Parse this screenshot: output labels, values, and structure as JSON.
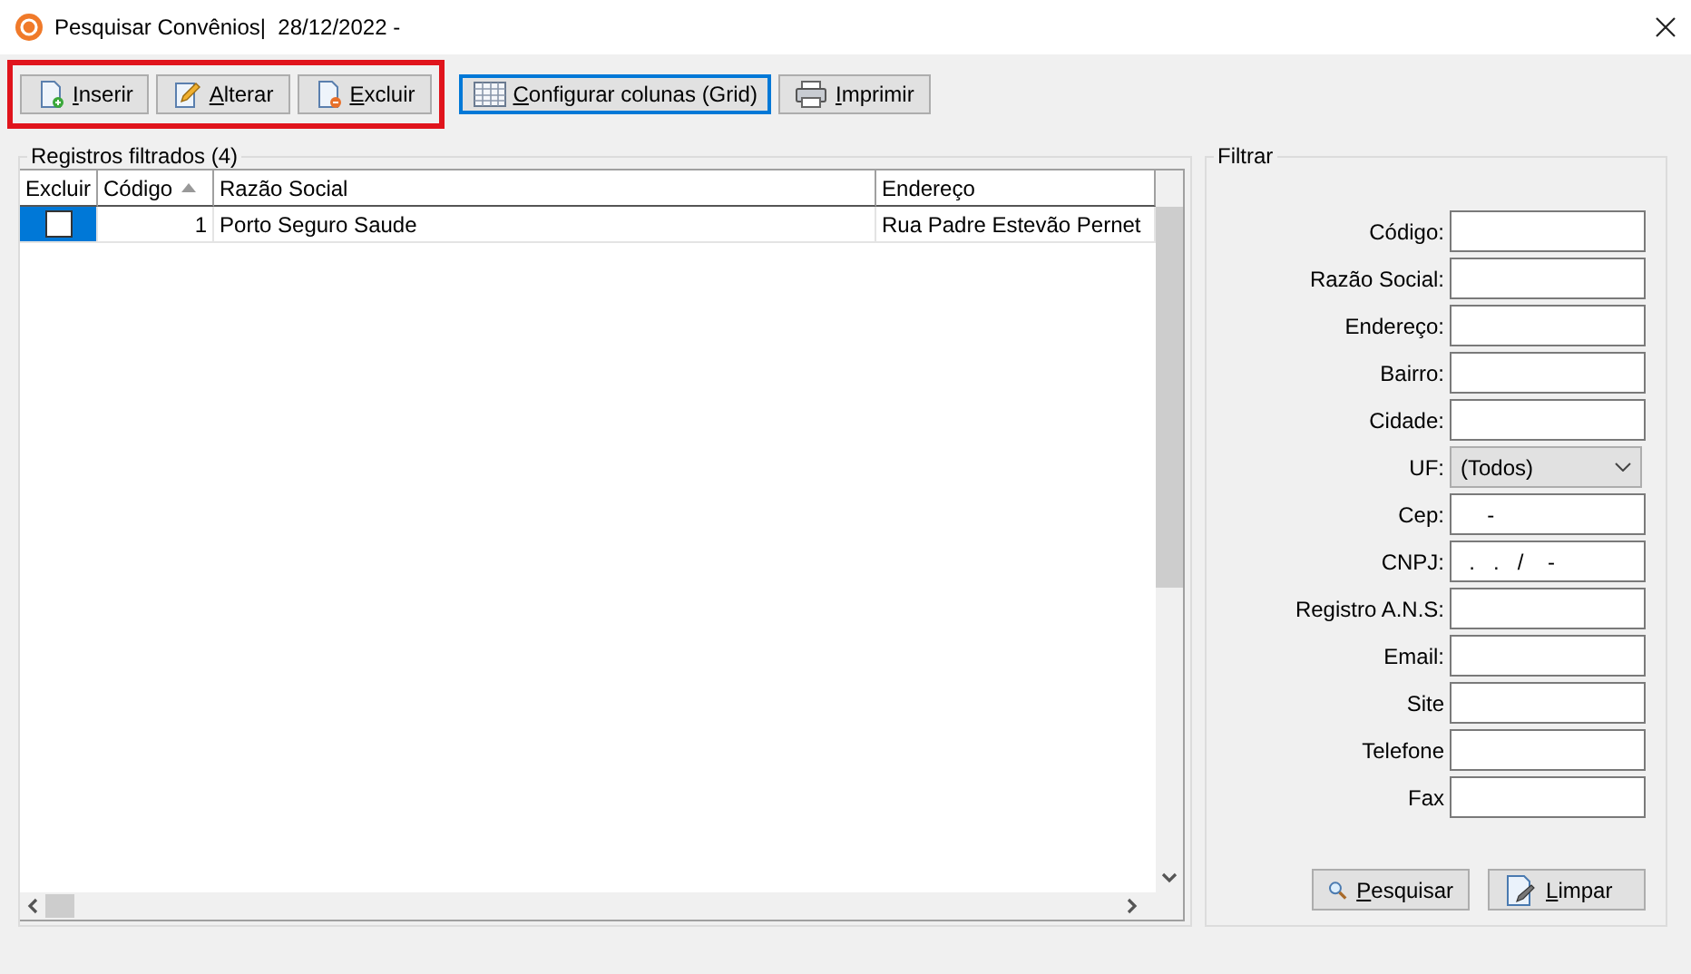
{
  "window": {
    "title": "Pesquisar Convênios|  28/12/2022 -"
  },
  "toolbar": [
    {
      "label": "Inserir",
      "kind": "insert",
      "highlighted": true,
      "focused": false
    },
    {
      "label": "Alterar",
      "kind": "edit",
      "highlighted": true,
      "focused": false
    },
    {
      "label": "Excluir",
      "kind": "delete",
      "highlighted": true,
      "focused": false
    },
    {
      "label": "Configurar colunas (Grid)",
      "kind": "columns",
      "highlighted": false,
      "focused": true
    },
    {
      "label": "Imprimir",
      "kind": "print",
      "highlighted": false,
      "focused": false
    }
  ],
  "grid": {
    "title": "Registros filtrados (4)",
    "columns": [
      {
        "label": "Excluir",
        "sorted": false
      },
      {
        "label": "Código",
        "sorted": true
      },
      {
        "label": "Razão Social",
        "sorted": false
      },
      {
        "label": "Endereço",
        "sorted": false
      }
    ],
    "rows": [
      {
        "selected": true,
        "cells": [
          {
            "checked": false
          },
          "1",
          "Porto Seguro Saude",
          "Rua Padre Estevão Pernet"
        ]
      }
    ]
  },
  "filter": {
    "title": "Filtrar",
    "fields": [
      {
        "label": "Código:",
        "kind": "text"
      },
      {
        "label": "Razão Social:",
        "kind": "text"
      },
      {
        "label": "Endereço:",
        "kind": "text"
      },
      {
        "label": "Bairro:",
        "kind": "text"
      },
      {
        "label": "Cidade:",
        "kind": "text"
      },
      {
        "label": "UF:",
        "kind": "select",
        "value": "(Todos)"
      },
      {
        "label": "Cep:",
        "kind": "text",
        "value": "     -"
      },
      {
        "label": "CNPJ:",
        "kind": "text",
        "value": "  .   .   /    -"
      },
      {
        "label": "Registro A.N.S:",
        "kind": "text"
      },
      {
        "label": "Email:",
        "kind": "text"
      },
      {
        "label": "Site",
        "kind": "text"
      },
      {
        "label": "Telefone",
        "kind": "text"
      },
      {
        "label": "Fax",
        "kind": "text"
      }
    ],
    "buttons": [
      {
        "label": "Pesquisar",
        "kind": "search"
      },
      {
        "label": "Limpar",
        "kind": "clear"
      }
    ]
  }
}
